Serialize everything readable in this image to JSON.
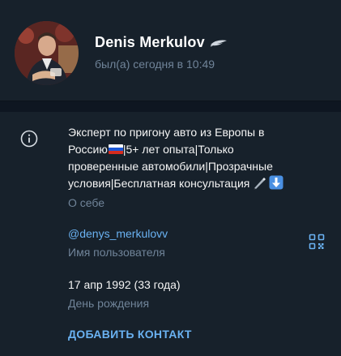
{
  "profile": {
    "name": "Denis Merkulov",
    "status": "был(а) сегодня в 10:49",
    "name_badge_icon": "feather-icon",
    "avatar_icon": "profile-photo"
  },
  "about": {
    "line1": "Эксперт по пригону авто из Европы в",
    "line2_prefix": "Россию",
    "line2_suffix": "|5+ лет опыта|Только",
    "line3": "проверенные автомобили|Прозрачные",
    "line4": "условия|Бесплатная консультация",
    "emojis": [
      "russian-flag-icon",
      "pen-icon",
      "down-arrow-icon"
    ],
    "label": "О себе"
  },
  "username": {
    "value": "@denys_merkulovv",
    "label": "Имя пользователя",
    "qr_icon": "qr-code-icon"
  },
  "birthday": {
    "value": "17 апр 1992 (33 года)",
    "label": "День рождения"
  },
  "actions": {
    "add_contact": "ДОБАВИТЬ КОНТАКТ"
  },
  "colors": {
    "background": "#17212b",
    "divider": "#0e1621",
    "text": "#f5f5f5",
    "secondary": "#708499",
    "accent": "#6ab2f2"
  }
}
